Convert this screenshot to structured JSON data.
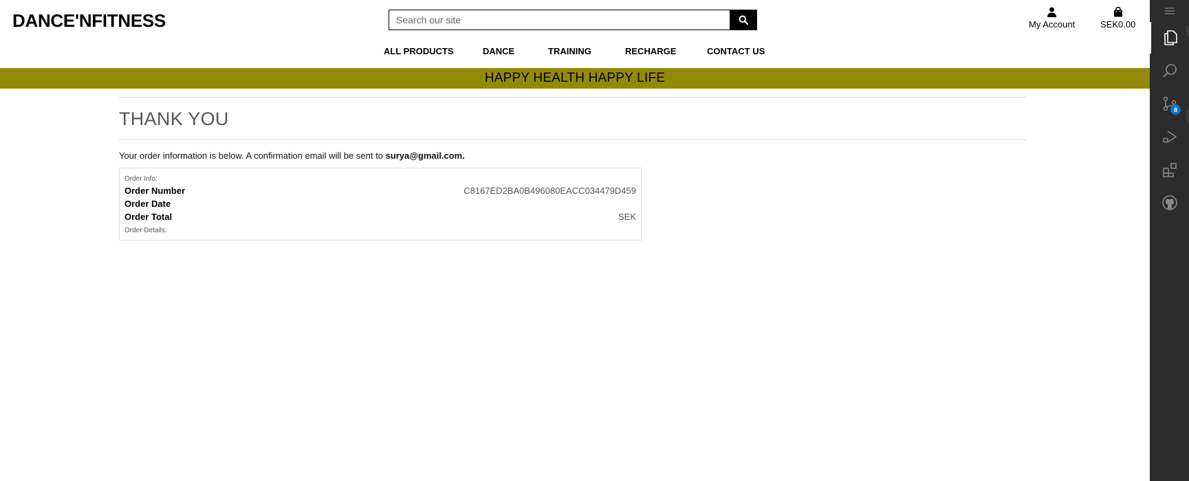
{
  "header": {
    "logo": "DANCE'NFITNESS",
    "search_placeholder": "Search our site",
    "account_label": "My Account",
    "cart_label": "SEK0.00"
  },
  "nav": {
    "items": [
      "ALL PRODUCTS",
      "DANCE",
      "TRAINING",
      "RECHARGE",
      "CONTACT US"
    ]
  },
  "banner": {
    "text": "HAPPY HEALTH HAPPY LIFE",
    "color": "#938a07"
  },
  "main": {
    "title": "THANK YOU",
    "intro_text": "Your order information is below. A confirmation email will be sent to ",
    "email": "surya@gmail.com",
    "intro_end": "."
  },
  "order": {
    "info_label": "Order Info:",
    "number_label": "Order Number",
    "number_value": "C8167ED2BA0B496080EACC034479D459",
    "date_label": "Order Date",
    "date_value": "",
    "total_label": "Order Total",
    "total_value": "SEK",
    "details_label": "Order Details:"
  },
  "activity_bar": {
    "icons": [
      "menu-icon",
      "explorer-icon",
      "search-icon",
      "source-control-icon",
      "run-debug-icon",
      "extensions-icon",
      "github-icon"
    ],
    "source_control_badge": "8",
    "badge_color": "#0078d4"
  }
}
